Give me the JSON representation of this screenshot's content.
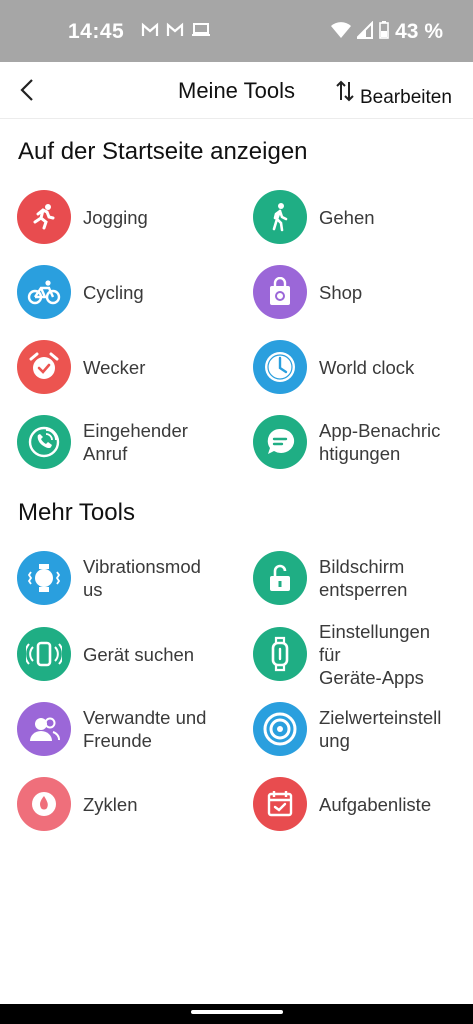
{
  "status_bar": {
    "time": "14:45",
    "battery": "43 %"
  },
  "header": {
    "title": "Meine Tools",
    "edit_label": "Bearbeiten"
  },
  "section_home": {
    "title": "Auf der Startseite anzeigen",
    "items": [
      {
        "label": "Jogging",
        "icon": "jogging-icon",
        "color": "#e84c4f"
      },
      {
        "label": "Gehen",
        "icon": "walking-icon",
        "color": "#1fae84"
      },
      {
        "label": "Cycling",
        "icon": "bike-icon",
        "color": "#2a9fde"
      },
      {
        "label": "Shop",
        "icon": "shop-bag-icon",
        "color": "#9b67d8"
      },
      {
        "label": "Wecker",
        "icon": "alarm-clock-icon",
        "color": "#ec5450"
      },
      {
        "label": "World clock",
        "icon": "world-clock-icon",
        "color": "#2a9fde"
      },
      {
        "label": "Eingehender\nAnruf",
        "icon": "phone-call-icon",
        "color": "#1fae84"
      },
      {
        "label": "App-Benachric\nhtigungen",
        "icon": "chat-bubble-icon",
        "color": "#1fae84"
      }
    ]
  },
  "section_more": {
    "title": "Mehr Tools",
    "items": [
      {
        "label": "Vibrationsmod\nus",
        "icon": "vibration-watch-icon",
        "color": "#2a9fde"
      },
      {
        "label": "Bildschirm\nentsperren",
        "icon": "unlock-icon",
        "color": "#1fae84"
      },
      {
        "label": "Gerät suchen",
        "icon": "find-device-icon",
        "color": "#1fae84"
      },
      {
        "label": "Einstellungen\nfür\nGeräte-Apps",
        "icon": "band-settings-icon",
        "color": "#1fae84"
      },
      {
        "label": "Verwandte und\nFreunde",
        "icon": "people-icon",
        "color": "#9b67d8"
      },
      {
        "label": "Zielwerteinstell\nung",
        "icon": "target-icon",
        "color": "#2a9fde"
      },
      {
        "label": "Zyklen",
        "icon": "cycle-icon",
        "color": "#ef6f7b"
      },
      {
        "label": "Aufgabenliste",
        "icon": "task-list-icon",
        "color": "#e84c4f"
      }
    ]
  }
}
